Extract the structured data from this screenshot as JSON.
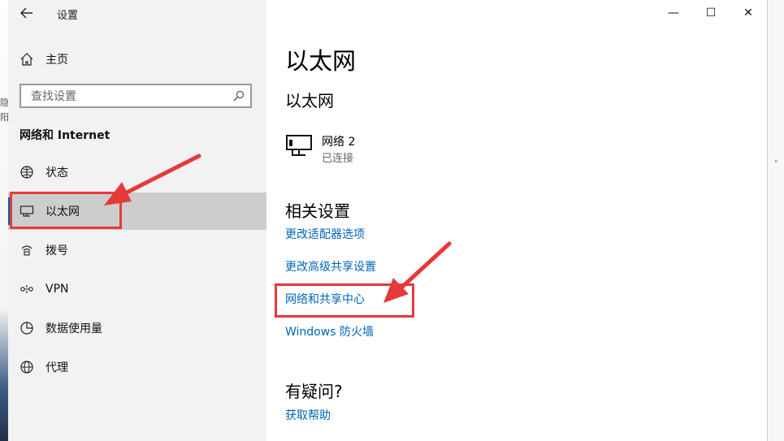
{
  "window": {
    "app_title": "设置",
    "controls": {
      "minimize": "—",
      "maximize": "☐",
      "close": "✕"
    }
  },
  "sidebar": {
    "home_label": "主页",
    "search_placeholder": "查找设置",
    "section_title": "网络和 Internet",
    "items": [
      {
        "label": "状态",
        "icon": "status-globe-icon"
      },
      {
        "label": "以太网",
        "icon": "ethernet-monitor-icon",
        "selected": true
      },
      {
        "label": "拨号",
        "icon": "dialup-icon"
      },
      {
        "label": "VPN",
        "icon": "vpn-icon"
      },
      {
        "label": "数据使用量",
        "icon": "data-usage-icon"
      },
      {
        "label": "代理",
        "icon": "proxy-globe-icon"
      }
    ]
  },
  "main": {
    "page_title": "以太网",
    "subtitle": "以太网",
    "network": {
      "name": "网络 2",
      "status": "已连接"
    },
    "related_heading": "相关设置",
    "links": [
      "更改适配器选项",
      "更改高级共享设置",
      "网络和共享中心",
      "Windows 防火墙"
    ],
    "help_heading": "有疑问?",
    "help_link": "获取帮助"
  },
  "annotations": {
    "color": "#e53a3a",
    "accent": "#0063b1",
    "link_color": "#0066b4"
  }
}
